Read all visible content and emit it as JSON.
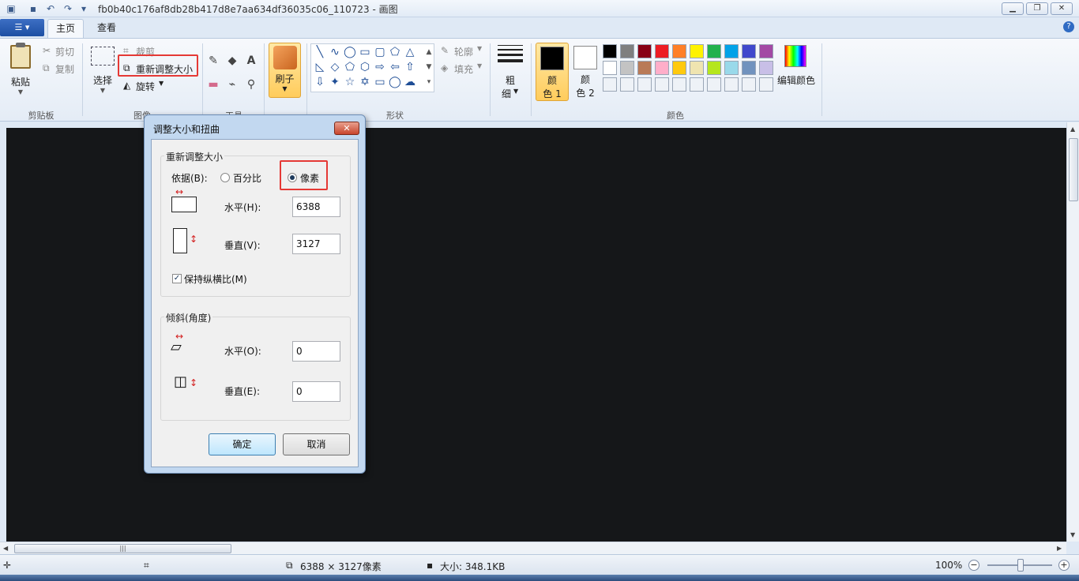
{
  "window": {
    "title": "fb0b40c176af8db28b417d8e7aa634df36035c06_110723 - 画图",
    "minimize": "▁",
    "maximize": "❐",
    "close": "✕"
  },
  "quick_access": {
    "save_icon": "save-icon",
    "undo_icon": "undo-icon",
    "redo_icon": "redo-icon",
    "customize_icon": "dropdown-icon"
  },
  "tabs": {
    "home": "主页",
    "view": "查看"
  },
  "clipboard": {
    "paste": "粘贴",
    "cut": "剪切",
    "copy": "复制",
    "group_label": "剪贴板"
  },
  "image": {
    "select": "选择",
    "crop": "裁剪",
    "resize": "重新调整大小",
    "rotate": "旋转",
    "group_label": "图像"
  },
  "tools": {
    "group_label": "工具"
  },
  "brushes": {
    "label": "刷子"
  },
  "shapes": {
    "outline": "轮廓",
    "fill": "填充",
    "group_label": "形状"
  },
  "size": {
    "label_top": "粗",
    "label_bottom": "细"
  },
  "colors": {
    "color1_top": "颜",
    "color1_bottom": "色 1",
    "color2_top": "颜",
    "color2_bottom": "色 2",
    "edit_colors": "编辑颜色",
    "group_label": "颜色",
    "color1_value": "#000000",
    "color2_value": "#ffffff",
    "palette_row1": [
      "#000000",
      "#7f7f7f",
      "#880015",
      "#ed1c24",
      "#ff7f27",
      "#fff200",
      "#22b14c",
      "#00a2e8",
      "#3f48cc",
      "#a349a4"
    ],
    "palette_row2": [
      "#ffffff",
      "#c3c3c3",
      "#b97a57",
      "#ffaec9",
      "#ffc90e",
      "#efe4b0",
      "#b5e61d",
      "#99d9ea",
      "#7092be",
      "#c8bfe7"
    ]
  },
  "dialog": {
    "title": "调整大小和扭曲",
    "close": "✕",
    "resize_legend": "重新调整大小",
    "by_label": "依据(B):",
    "percent_option": "百分比",
    "pixels_option": "像素",
    "horizontal_label": "水平(H):",
    "horizontal_value": "6388",
    "vertical_label": "垂直(V):",
    "vertical_value": "3127",
    "keep_ratio_label": "保持纵横比(M)",
    "keep_ratio_checked": true,
    "skew_legend": "倾斜(角度)",
    "skew_horizontal_label": "水平(O):",
    "skew_horizontal_value": "0",
    "skew_vertical_label": "垂直(E):",
    "skew_vertical_value": "0",
    "ok": "确定",
    "cancel": "取消"
  },
  "status": {
    "dimensions": "6388 × 3127像素",
    "file_size": "大小: 348.1KB",
    "zoom": "100%"
  },
  "accent": {
    "highlight": "#e53935",
    "canvas_bg": "#151719"
  }
}
